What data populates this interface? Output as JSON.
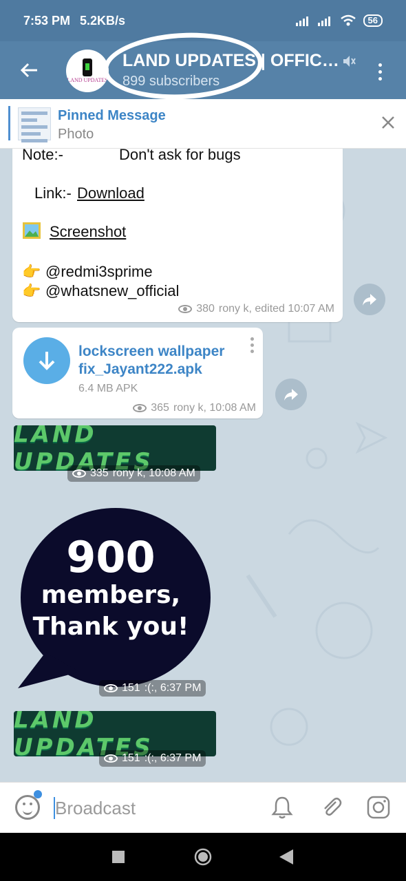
{
  "status_bar": {
    "time": "7:53 PM",
    "speed": "5.2KB/s",
    "battery": "56"
  },
  "header": {
    "title": "LAND UPDATES | OFFICI…",
    "subscribers": "899 subscribers",
    "avatar_text": "LAND UPDATES"
  },
  "pinned": {
    "title": "Pinned Message",
    "subtitle": "Photo"
  },
  "message1": {
    "note_label": "Note:-",
    "note_text": "Don't ask for bugs",
    "link_label": "Link:-",
    "link_text": "Download",
    "screenshot_text": "Screenshot",
    "mention1": "@redmi3sprime",
    "mention2": "@whatsnew_official",
    "views": "380",
    "meta": "rony k, edited 10:07 AM"
  },
  "message2": {
    "file_name": "lockscreen wallpaper fix_Jayant222.apk",
    "file_size": "6.4 MB APK",
    "views": "365",
    "meta": "rony k, 10:08 AM"
  },
  "message3": {
    "banner_text": "LAND UPDATES",
    "views": "335",
    "meta": "rony k, 10:08 AM"
  },
  "message4": {
    "line1": "900",
    "line2": "members,",
    "line3": "Thank you!",
    "views": "151",
    "meta": ":(:, 6:37 PM"
  },
  "message5": {
    "banner_text": "LAND UPDATES",
    "views": "151",
    "meta": ":(:, 6:37 PM"
  },
  "input": {
    "placeholder": "Broadcast"
  },
  "colors": {
    "header": "#5682a8",
    "accent": "#3d85c6",
    "chat_bg": "#cbd8e1"
  }
}
